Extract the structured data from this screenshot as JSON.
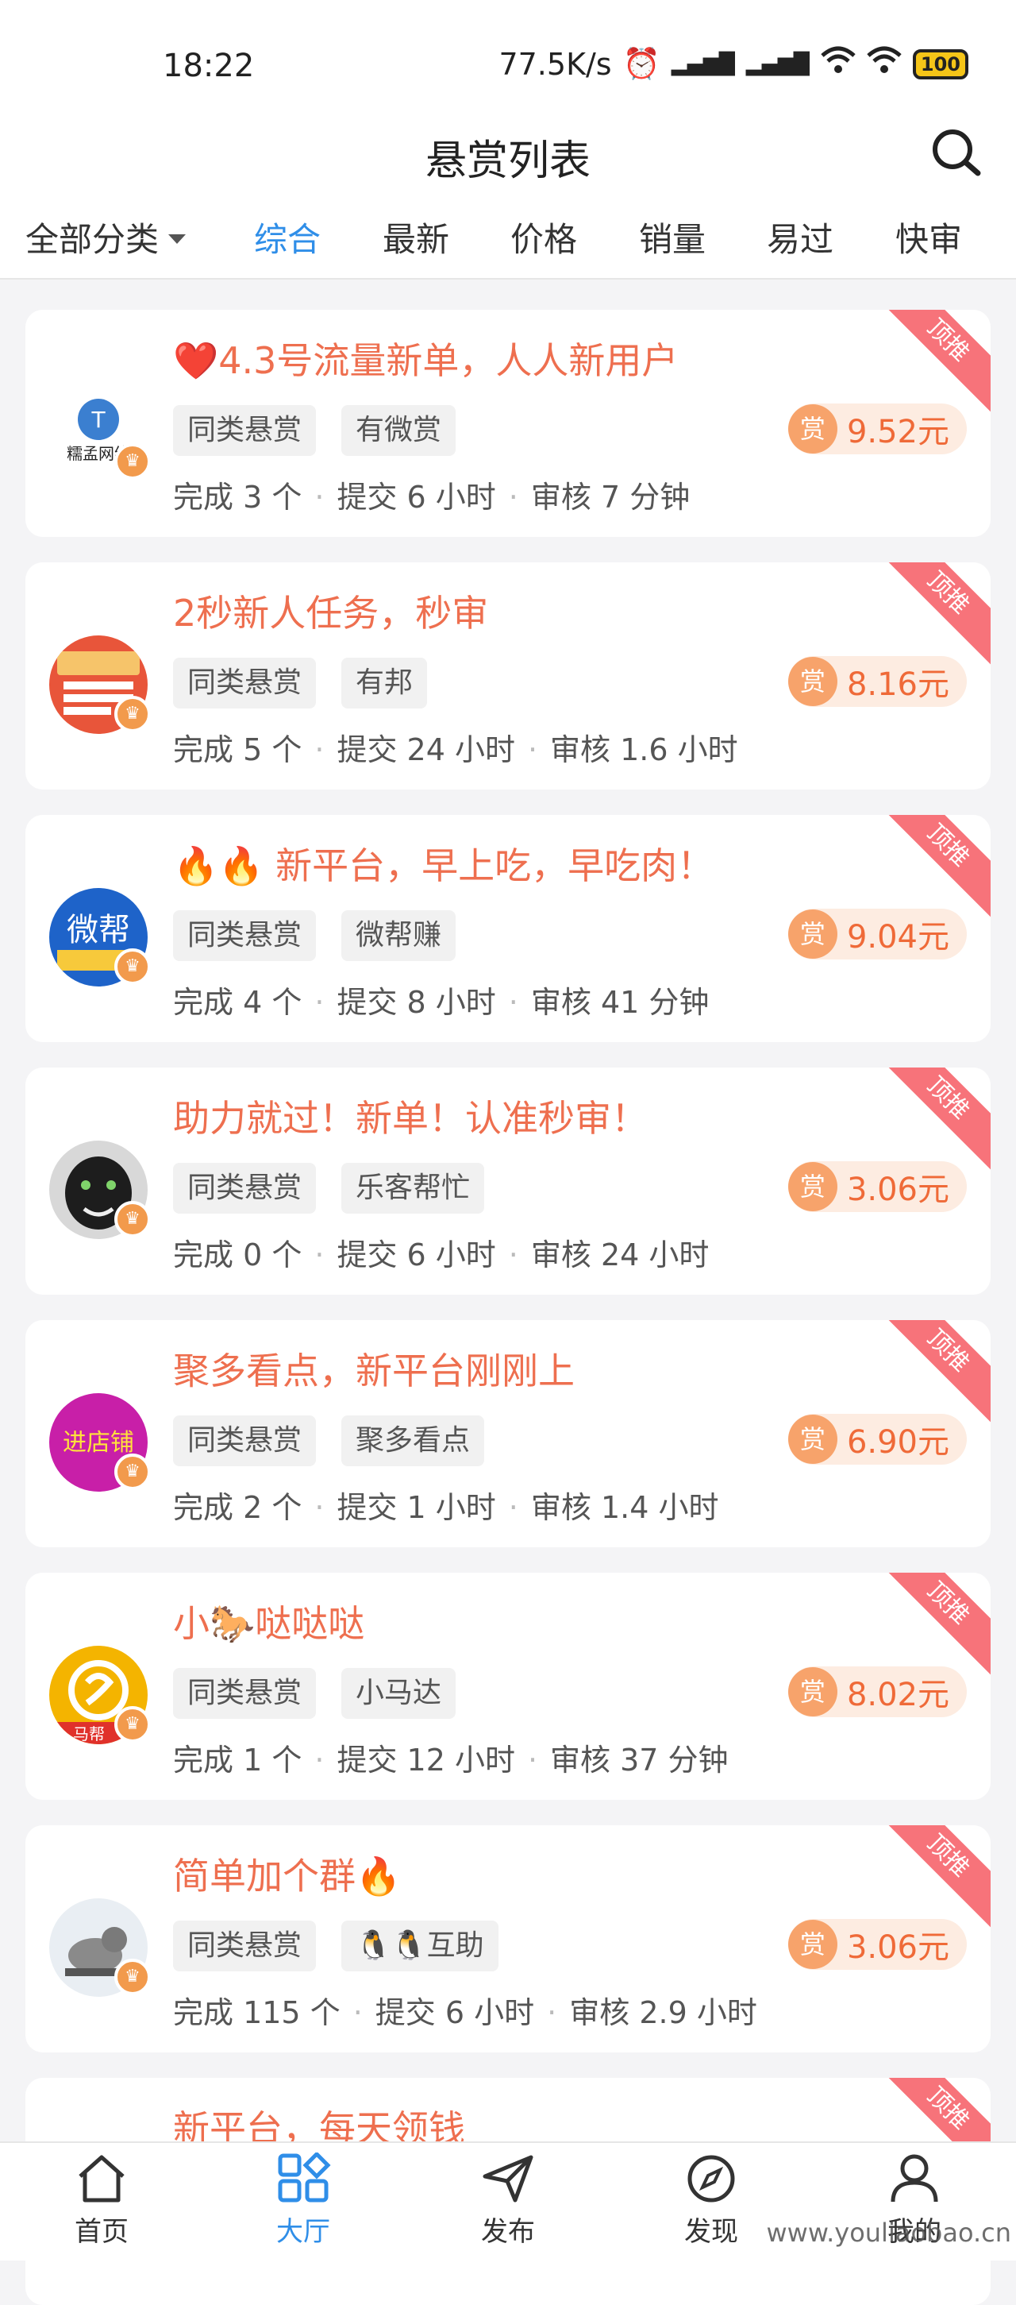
{
  "status_bar": {
    "time": "18:22",
    "network_speed": "77.5K/s",
    "battery": "100"
  },
  "header": {
    "title": "悬赏列表"
  },
  "tabs": {
    "category": "全部分类",
    "items": [
      "综合",
      "最新",
      "价格",
      "销量",
      "易过",
      "快审"
    ],
    "active": "综合"
  },
  "listings": [
    {
      "title": "❤️4.3号流量新单，人人新用户",
      "tag1": "同类悬赏",
      "tag2": "有微赏",
      "reward_badge": "赏",
      "reward": "9.52元",
      "completed": "完成 3 个",
      "submit": "提交 6 小时",
      "review": "审核 7 分钟",
      "ribbon": "顶推",
      "avatar_text": "糯孟网络"
    },
    {
      "title": "2秒新人任务，秒审",
      "tag1": "同类悬赏",
      "tag2": "有邦",
      "reward_badge": "赏",
      "reward": "8.16元",
      "completed": "完成 5 个",
      "submit": "提交 24 小时",
      "review": "审核 1.6 小时",
      "ribbon": "顶推",
      "avatar_text": ""
    },
    {
      "title": "🔥🔥 新平台，早上吃，早吃肉！",
      "tag1": "同类悬赏",
      "tag2": "微帮赚",
      "reward_badge": "赏",
      "reward": "9.04元",
      "completed": "完成 4 个",
      "submit": "提交 8 小时",
      "review": "审核 41 分钟",
      "ribbon": "顶推",
      "avatar_text": "微帮"
    },
    {
      "title": "助力就过！新单！认准秒审！",
      "tag1": "同类悬赏",
      "tag2": "乐客帮忙",
      "reward_badge": "赏",
      "reward": "3.06元",
      "completed": "完成 0 个",
      "submit": "提交 6 小时",
      "review": "审核 24 小时",
      "ribbon": "顶推",
      "avatar_text": ""
    },
    {
      "title": "聚多看点，新平台刚刚上",
      "tag1": "同类悬赏",
      "tag2": "聚多看点",
      "reward_badge": "赏",
      "reward": "6.90元",
      "completed": "完成 2 个",
      "submit": "提交 1 小时",
      "review": "审核 1.4 小时",
      "ribbon": "顶推",
      "avatar_text": "进店铺"
    },
    {
      "title": "小🐎哒哒哒",
      "tag1": "同类悬赏",
      "tag2": "小马达",
      "reward_badge": "赏",
      "reward": "8.02元",
      "completed": "完成 1 个",
      "submit": "提交 12 小时",
      "review": "审核 37 分钟",
      "ribbon": "顶推",
      "avatar_text": "马帮"
    },
    {
      "title": "简单加个群🔥",
      "tag1": "同类悬赏",
      "tag2": "🐧🐧互助",
      "reward_badge": "赏",
      "reward": "3.06元",
      "completed": "完成 115 个",
      "submit": "提交 6 小时",
      "review": "审核 2.9 小时",
      "ribbon": "顶推",
      "avatar_text": ""
    },
    {
      "title": "新平台，每天领钱",
      "ribbon": "顶推"
    }
  ],
  "bottom_nav": {
    "items": [
      "首页",
      "大厅",
      "发布",
      "发现",
      "我的"
    ],
    "active": "大厅"
  },
  "watermark": "www.youliaobao.cn",
  "colors": {
    "accent_blue": "#2f8ee8",
    "title_orange": "#ee6f4f",
    "reward_orange": "#ef6a38",
    "ribbon_pink": "#f7737a"
  }
}
